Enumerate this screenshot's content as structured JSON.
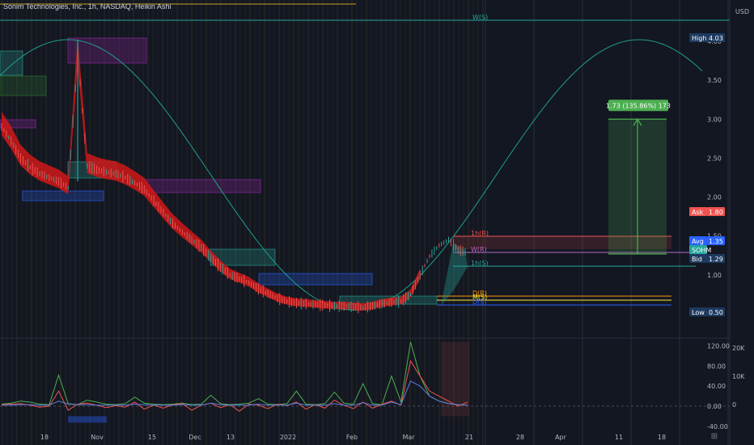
{
  "header": {
    "title": "Sonim Technologies, Inc., 1h, NASDAQ, Heikin Ashi"
  },
  "colors": {
    "background": "#131722",
    "bullish": "#26a69a",
    "bearish": "#ef5350",
    "band": "#d01818",
    "arc": "#1f9e89",
    "projection": "#4caf50",
    "grid_stripes": "#8a7a1e"
  },
  "chart_data": [
    {
      "type": "line",
      "title": "Sonim Technologies, Inc., 1h, NASDAQ, Heikin Ashi",
      "y_axis": {
        "unit": "USD",
        "ticks": [
          "4.00",
          "3.50",
          "3.00",
          "2.50",
          "2.00",
          "1.50",
          "1.00"
        ],
        "range": [
          0.3,
          4.5
        ]
      },
      "x_axis": {
        "ticks": [
          "18",
          "Nov",
          "15",
          "Dec",
          "13",
          "2022",
          "Feb",
          "Mar",
          "21",
          "28",
          "Apr",
          "11",
          "18"
        ]
      },
      "series": [
        {
          "values": [
            2.9,
            2.72,
            2.5,
            2.38,
            2.3,
            2.25,
            2.2,
            2.12,
            3.82,
            2.4,
            2.35,
            2.32,
            2.3,
            2.25,
            2.18,
            2.1,
            1.95,
            1.8,
            1.66,
            1.55,
            1.45,
            1.35,
            1.22,
            1.1,
            1.0,
            0.95,
            0.9,
            0.82,
            0.76,
            0.7,
            0.66,
            0.64,
            0.63,
            0.62,
            0.61,
            0.6,
            0.6,
            0.59,
            0.58,
            0.6,
            0.63,
            0.65,
            0.66,
            0.75,
            1.0,
            1.24,
            1.38,
            1.45,
            1.32,
            1.29
          ]
        }
      ],
      "price_labels": [
        {
          "label": "High",
          "value": "4.03"
        },
        {
          "label": "Ask",
          "value": "1.80"
        },
        {
          "label": "Avg",
          "value": "1.35"
        },
        {
          "label": "SOHM",
          "value": ""
        },
        {
          "label": "Bid",
          "value": "1.29"
        },
        {
          "label": "Low",
          "value": "0.50"
        }
      ],
      "level_labels": [
        "W(S)",
        "1h(R)",
        "W(R)",
        "1h(S)",
        "D(R)",
        "M(S)",
        "D(S)"
      ],
      "projection": {
        "label": "1.73 (135.86%) 173",
        "from": 1.27,
        "to": 3.0
      },
      "arc": {
        "low": 0.55,
        "high": 4.02
      }
    },
    {
      "type": "line",
      "title": "",
      "y_axis": {
        "ticks": [
          "120.00",
          "80.00",
          "40.00",
          "0.00",
          "-40.00"
        ],
        "range": [
          -45,
          130
        ]
      },
      "right_axis": {
        "ticks": [
          "20K",
          "10K",
          "0"
        ]
      },
      "series": [
        {
          "color": "#4caf50",
          "values": [
            4,
            6,
            10,
            8,
            4,
            3,
            62,
            5,
            3,
            12,
            8,
            4,
            3,
            5,
            18,
            6,
            4,
            3,
            4,
            6,
            3,
            4,
            22,
            5,
            3,
            4,
            6,
            15,
            4,
            3,
            5,
            30,
            4,
            3,
            5,
            28,
            6,
            4,
            45,
            5,
            3,
            60,
            8,
            128,
            60,
            20,
            10,
            5,
            3,
            2
          ]
        },
        {
          "color": "#ef5350",
          "values": [
            3,
            4,
            5,
            2,
            -2,
            0,
            30,
            -8,
            4,
            6,
            2,
            -3,
            1,
            -2,
            8,
            -6,
            2,
            -4,
            3,
            5,
            -8,
            2,
            6,
            -3,
            3,
            -10,
            4,
            2,
            -5,
            4,
            1,
            8,
            -6,
            3,
            -4,
            12,
            2,
            -5,
            8,
            -4,
            4,
            10,
            2,
            90,
            60,
            30,
            20,
            10,
            0,
            8
          ]
        },
        {
          "color": "#5b7fe0",
          "values": [
            2,
            2,
            3,
            3,
            2,
            2,
            10,
            4,
            3,
            3,
            2,
            2,
            2,
            2,
            4,
            3,
            2,
            2,
            2,
            3,
            2,
            2,
            6,
            3,
            2,
            2,
            2,
            4,
            2,
            2,
            2,
            6,
            2,
            2,
            2,
            5,
            2,
            2,
            7,
            2,
            2,
            8,
            3,
            50,
            40,
            20,
            10,
            5,
            3,
            2
          ]
        }
      ]
    }
  ]
}
